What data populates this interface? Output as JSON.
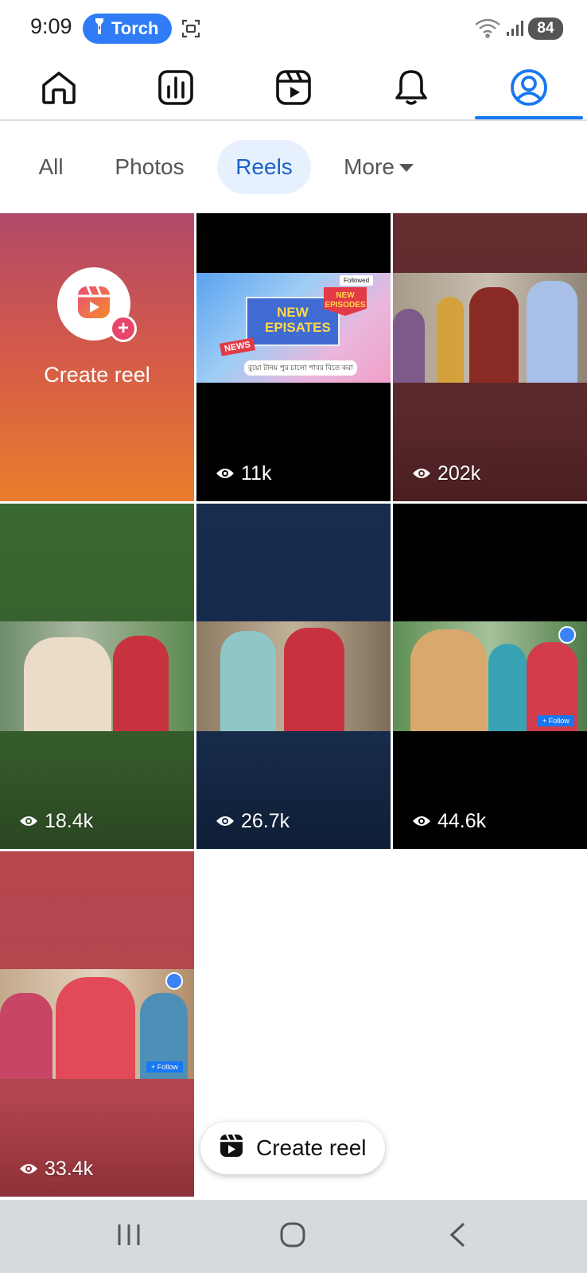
{
  "status_bar": {
    "time": "9:09",
    "torch_label": "Torch",
    "battery": "84",
    "icons": [
      "flashlight-icon",
      "screenshot-icon",
      "wifi-icon",
      "signal-icon"
    ]
  },
  "top_nav": {
    "items": [
      {
        "icon": "home-icon",
        "active": false
      },
      {
        "icon": "dashboard-chart-icon",
        "active": false
      },
      {
        "icon": "video-reels-icon",
        "active": false
      },
      {
        "icon": "notification-bell-icon",
        "active": false
      },
      {
        "icon": "profile-icon",
        "active": true
      }
    ],
    "accent": "#1877f2"
  },
  "filter_tabs": {
    "items": [
      {
        "label": "All",
        "active": false
      },
      {
        "label": "Photos",
        "active": false
      },
      {
        "label": "Reels",
        "active": true
      },
      {
        "label": "More",
        "active": false
      }
    ]
  },
  "grid": {
    "create_tile": {
      "label": "Create reel"
    },
    "reels": [
      {
        "views": "11k",
        "background": "#000000",
        "thumb_text": {
          "tag": "Followed",
          "headline": "NEW EPISATES",
          "badge": "NEW EPISODES",
          "news": "NEWS",
          "caption": "বুয়ো টানয় পুর চালো পাবর বিতে করা"
        }
      },
      {
        "views": "202k",
        "background": "#5e2a2d"
      },
      {
        "views": "18.4k",
        "background": "#355a2c"
      },
      {
        "views": "26.7k",
        "background": "#17294a"
      },
      {
        "views": "44.6k",
        "background": "#000000",
        "thumb_text": {
          "follow": "+ Follow"
        }
      },
      {
        "views": "33.4k",
        "background": "#b2464f",
        "thumb_text": {
          "follow": "+ Follow"
        }
      }
    ]
  },
  "fab": {
    "label": "Create reel"
  },
  "system_nav": {
    "icons": [
      "recent-apps-icon",
      "home-circle-icon",
      "back-icon"
    ]
  }
}
